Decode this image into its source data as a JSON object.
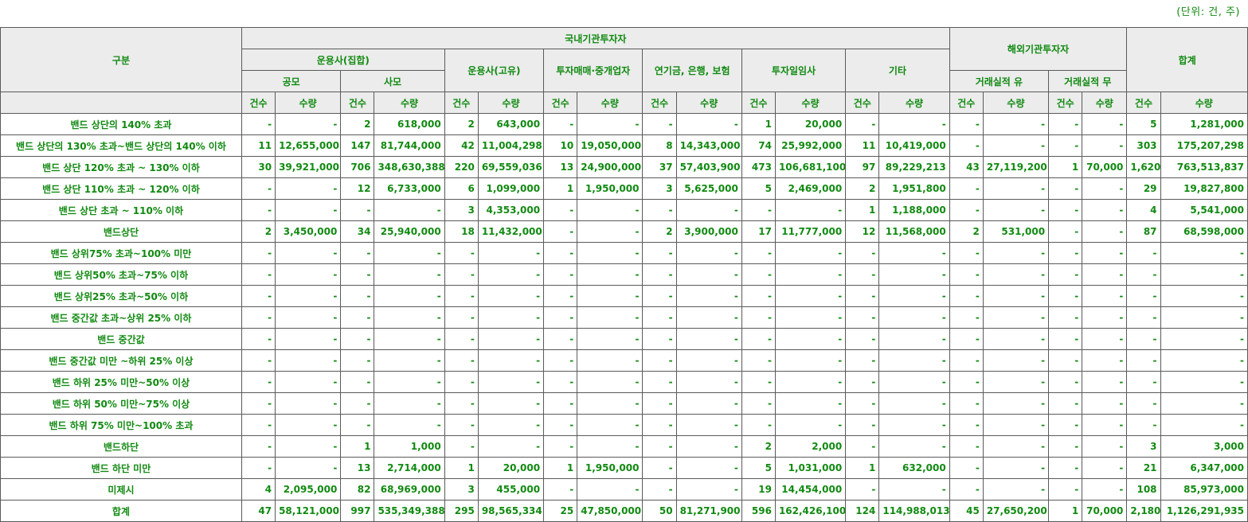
{
  "unit_note": "(단위: 건, 주)",
  "header": {
    "category": "구분",
    "domestic": "국내기관투자자",
    "foreign": "해외기관투자자",
    "total": "합계",
    "asset_mgmt_collective": "운용사(집합)",
    "asset_mgmt_proprietary": "운용사(고유)",
    "brokers": "투자매매·중개업자",
    "pension": "연기금, 은행, 보험",
    "discretionary": "투자일임사",
    "other": "기타",
    "foreign_with_history": "거래실적 유",
    "foreign_no_history": "거래실적 무",
    "public": "공모",
    "private": "사모",
    "count": "건수",
    "quantity": "수량"
  },
  "rows": [
    {
      "label": "밴드 상단의 140% 초과",
      "cells": [
        "-",
        "-",
        "2",
        "618,000",
        "2",
        "643,000",
        "-",
        "-",
        "-",
        "-",
        "1",
        "20,000",
        "-",
        "-",
        "-",
        "-",
        "-",
        "-",
        "5",
        "1,281,000"
      ]
    },
    {
      "label": "밴드 상단의 130% 초과~밴드 상단의 140% 이하",
      "cells": [
        "11",
        "12,655,000",
        "147",
        "81,744,000",
        "42",
        "11,004,298",
        "10",
        "19,050,000",
        "8",
        "14,343,000",
        "74",
        "25,992,000",
        "11",
        "10,419,000",
        "-",
        "-",
        "-",
        "-",
        "303",
        "175,207,298"
      ]
    },
    {
      "label": "밴드 상단 120% 초과 ~ 130% 이하",
      "cells": [
        "30",
        "39,921,000",
        "706",
        "348,630,388",
        "220",
        "69,559,036",
        "13",
        "24,900,000",
        "37",
        "57,403,900",
        "473",
        "106,681,100",
        "97",
        "89,229,213",
        "43",
        "27,119,200",
        "1",
        "70,000",
        "1,620",
        "763,513,837"
      ]
    },
    {
      "label": "밴드 상단 110% 초과 ~ 120% 이하",
      "cells": [
        "-",
        "-",
        "12",
        "6,733,000",
        "6",
        "1,099,000",
        "1",
        "1,950,000",
        "3",
        "5,625,000",
        "5",
        "2,469,000",
        "2",
        "1,951,800",
        "-",
        "-",
        "-",
        "-",
        "29",
        "19,827,800"
      ]
    },
    {
      "label": "밴드 상단 초과 ~ 110% 이하",
      "cells": [
        "-",
        "-",
        "-",
        "-",
        "3",
        "4,353,000",
        "-",
        "-",
        "-",
        "-",
        "-",
        "-",
        "1",
        "1,188,000",
        "-",
        "-",
        "-",
        "-",
        "4",
        "5,541,000"
      ]
    },
    {
      "label": "밴드상단",
      "cells": [
        "2",
        "3,450,000",
        "34",
        "25,940,000",
        "18",
        "11,432,000",
        "-",
        "-",
        "2",
        "3,900,000",
        "17",
        "11,777,000",
        "12",
        "11,568,000",
        "2",
        "531,000",
        "-",
        "-",
        "87",
        "68,598,000"
      ]
    },
    {
      "label": "밴드 상위75% 초과~100% 미만",
      "cells": [
        "-",
        "-",
        "-",
        "-",
        "-",
        "-",
        "-",
        "-",
        "-",
        "-",
        "-",
        "-",
        "-",
        "-",
        "-",
        "-",
        "-",
        "-",
        "-",
        "-"
      ]
    },
    {
      "label": "밴드 상위50% 초과~75% 이하",
      "cells": [
        "-",
        "-",
        "-",
        "-",
        "-",
        "-",
        "-",
        "-",
        "-",
        "-",
        "-",
        "-",
        "-",
        "-",
        "-",
        "-",
        "-",
        "-",
        "-",
        "-"
      ]
    },
    {
      "label": "밴드 상위25% 초과~50% 이하",
      "cells": [
        "-",
        "-",
        "-",
        "-",
        "-",
        "-",
        "-",
        "-",
        "-",
        "-",
        "-",
        "-",
        "-",
        "-",
        "-",
        "-",
        "-",
        "-",
        "-",
        "-"
      ]
    },
    {
      "label": "밴드 중간값 초과~상위 25% 이하",
      "cells": [
        "-",
        "-",
        "-",
        "-",
        "-",
        "-",
        "-",
        "-",
        "-",
        "-",
        "-",
        "-",
        "-",
        "-",
        "-",
        "-",
        "-",
        "-",
        "-",
        "-"
      ]
    },
    {
      "label": "밴드 중간값",
      "cells": [
        "-",
        "-",
        "-",
        "-",
        "-",
        "-",
        "-",
        "-",
        "-",
        "-",
        "-",
        "-",
        "-",
        "-",
        "-",
        "-",
        "-",
        "-",
        "-",
        "-"
      ]
    },
    {
      "label": "밴드 중간값 미만 ~하위 25% 이상",
      "cells": [
        "-",
        "-",
        "-",
        "-",
        "-",
        "-",
        "-",
        "-",
        "-",
        "-",
        "-",
        "-",
        "-",
        "-",
        "-",
        "-",
        "-",
        "-",
        "-",
        "-"
      ]
    },
    {
      "label": "밴드 하위 25% 미만~50% 이상",
      "cells": [
        "-",
        "-",
        "-",
        "-",
        "-",
        "-",
        "-",
        "-",
        "-",
        "-",
        "-",
        "-",
        "-",
        "-",
        "-",
        "-",
        "-",
        "-",
        "-",
        "-"
      ]
    },
    {
      "label": "밴드 하위 50% 미만~75% 이상",
      "cells": [
        "-",
        "-",
        "-",
        "-",
        "-",
        "-",
        "-",
        "-",
        "-",
        "-",
        "-",
        "-",
        "-",
        "-",
        "-",
        "-",
        "-",
        "-",
        "-",
        "-"
      ]
    },
    {
      "label": "밴드 하위 75% 미만~100% 초과",
      "cells": [
        "-",
        "-",
        "-",
        "-",
        "-",
        "-",
        "-",
        "-",
        "-",
        "-",
        "-",
        "-",
        "-",
        "-",
        "-",
        "-",
        "-",
        "-",
        "-",
        "-"
      ]
    },
    {
      "label": "밴드하단",
      "cells": [
        "-",
        "-",
        "1",
        "1,000",
        "-",
        "-",
        "-",
        "-",
        "-",
        "-",
        "2",
        "2,000",
        "-",
        "-",
        "-",
        "-",
        "-",
        "-",
        "3",
        "3,000"
      ]
    },
    {
      "label": "밴드 하단 미만",
      "cells": [
        "-",
        "-",
        "13",
        "2,714,000",
        "1",
        "20,000",
        "1",
        "1,950,000",
        "-",
        "-",
        "5",
        "1,031,000",
        "1",
        "632,000",
        "-",
        "-",
        "-",
        "-",
        "21",
        "6,347,000"
      ]
    },
    {
      "label": "미제시",
      "cells": [
        "4",
        "2,095,000",
        "82",
        "68,969,000",
        "3",
        "455,000",
        "-",
        "-",
        "-",
        "-",
        "19",
        "14,454,000",
        "-",
        "-",
        "-",
        "-",
        "-",
        "-",
        "108",
        "85,973,000"
      ]
    },
    {
      "label": "합계",
      "cells": [
        "47",
        "58,121,000",
        "997",
        "535,349,388",
        "295",
        "98,565,334",
        "25",
        "47,850,000",
        "50",
        "81,271,900",
        "596",
        "162,426,100",
        "124",
        "114,988,013",
        "45",
        "27,650,200",
        "1",
        "70,000",
        "2,180",
        "1,126,291,935"
      ]
    }
  ]
}
